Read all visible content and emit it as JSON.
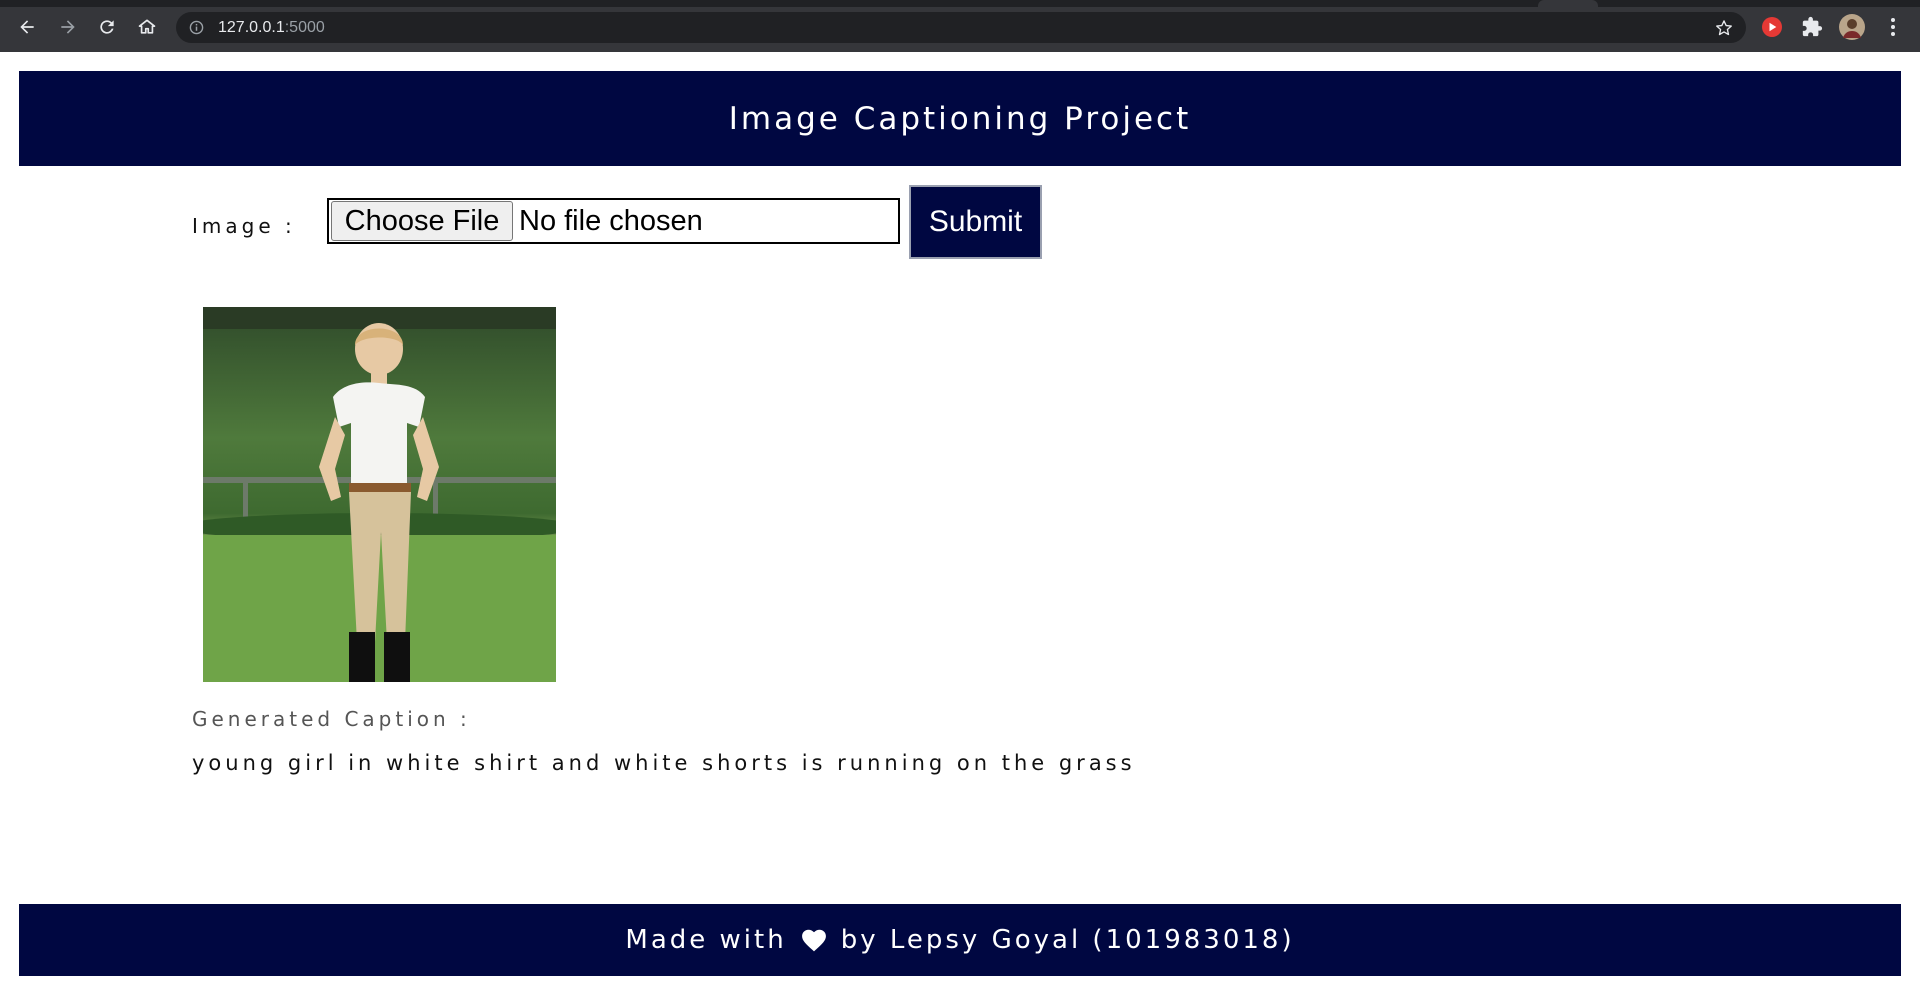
{
  "browser": {
    "url_host": "127.0.0.1",
    "url_port": ":5000"
  },
  "header": {
    "title": "Image Captioning Project"
  },
  "form": {
    "image_label": "Image :",
    "choose_file_label": "Choose File",
    "file_status": "No file chosen",
    "submit_label": "Submit"
  },
  "result": {
    "caption_label": "Generated Caption :",
    "caption_text": "young girl in white shirt and white shorts is running on the grass"
  },
  "footer": {
    "made_with": "Made with",
    "by_text": "by Lepsy Goyal (101983018)"
  },
  "colors": {
    "navy": "#000741",
    "chrome": "#35363a",
    "omnibox": "#202124"
  },
  "icons": [
    "back-arrow-icon",
    "forward-arrow-icon",
    "reload-icon",
    "home-icon",
    "info-icon",
    "star-icon",
    "youtube-extension-icon",
    "puzzle-icon",
    "avatar",
    "kebab-menu-icon",
    "heart-icon"
  ]
}
